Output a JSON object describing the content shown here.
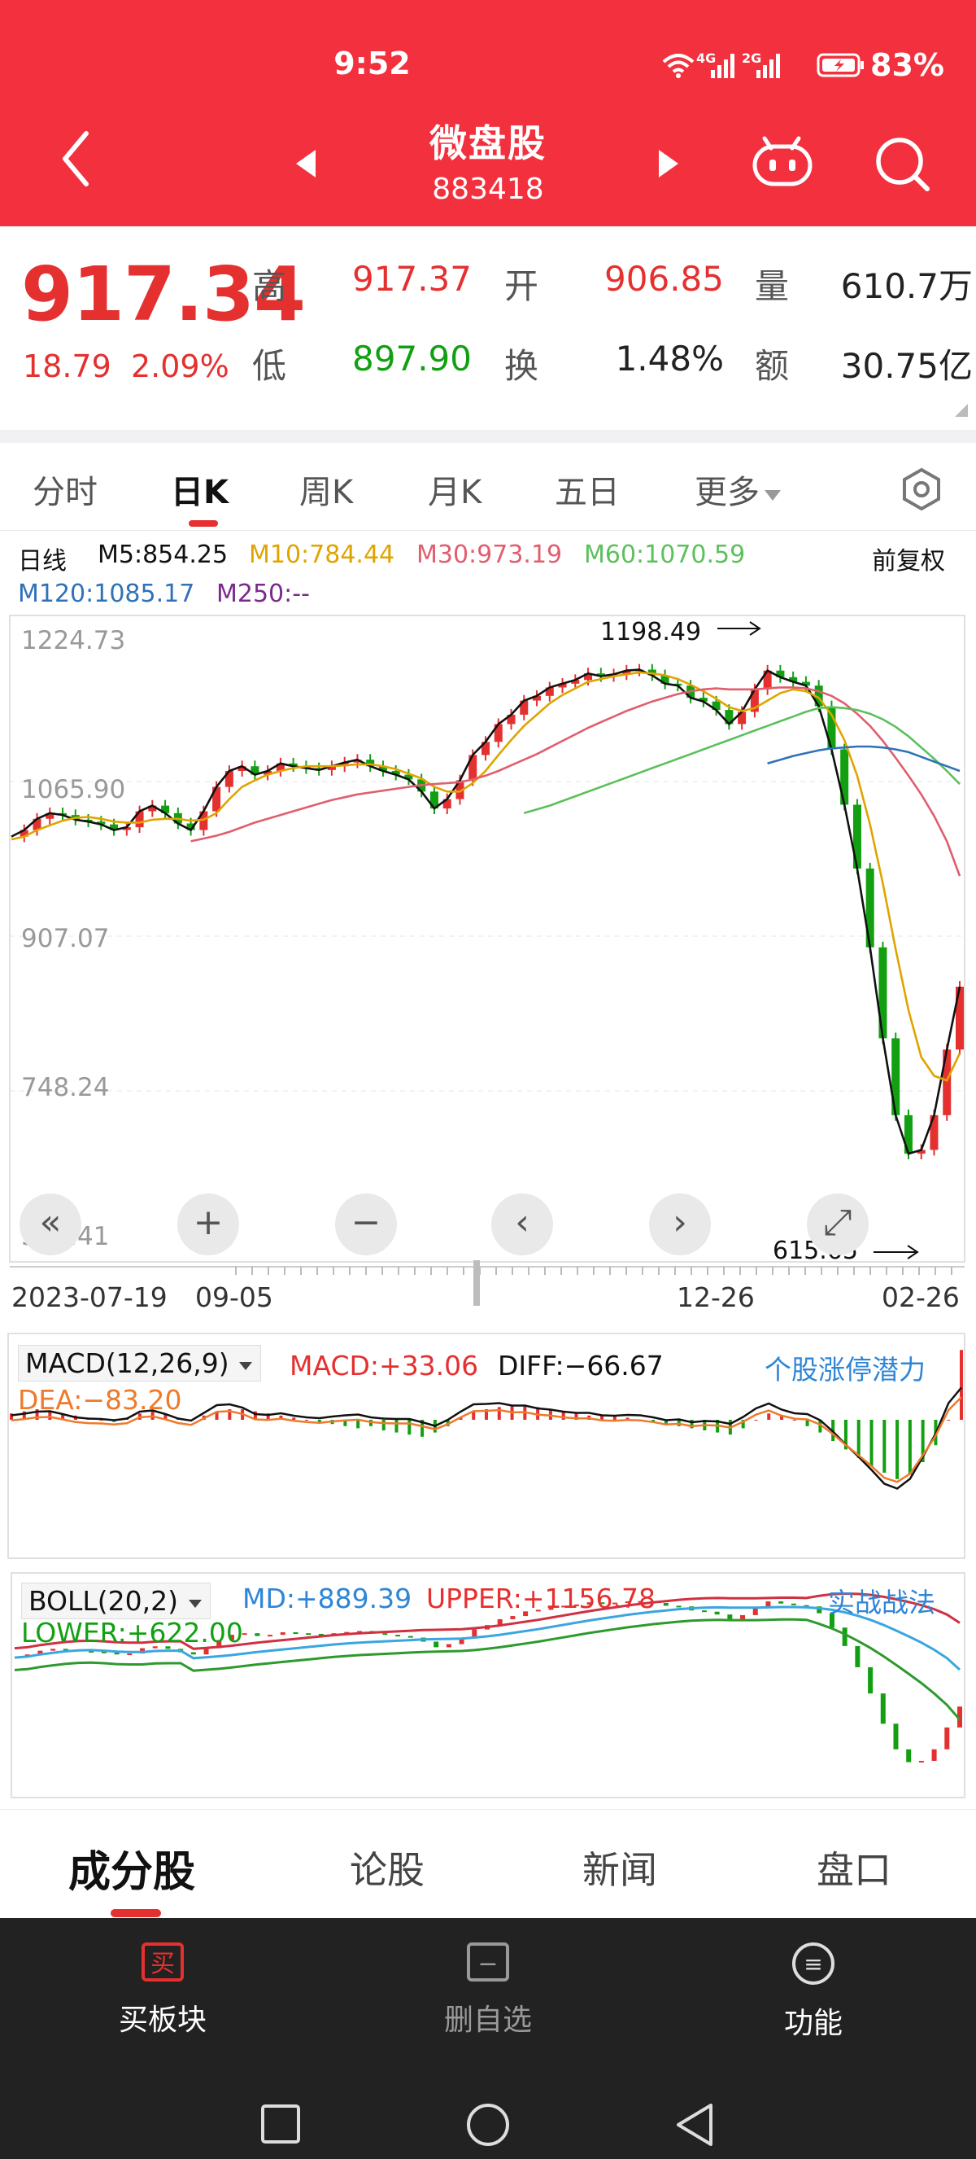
{
  "status_bar": {
    "time": "9:52",
    "net1": "4G",
    "net2": "2G",
    "battery": "83%"
  },
  "header": {
    "title": "微盘股",
    "code": "883418"
  },
  "quote": {
    "price": "917.34",
    "change": "18.79",
    "change_pct": "2.09%",
    "high_label": "高",
    "high": "917.37",
    "open_label": "开",
    "open": "906.85",
    "volume_label": "量",
    "volume": "610.7万",
    "low_label": "低",
    "low": "897.90",
    "turnover_label": "换",
    "turnover": "1.48%",
    "amount_label": "额",
    "amount": "30.75亿"
  },
  "tabs": [
    "分时",
    "日K",
    "周K",
    "月K",
    "五日",
    "更多"
  ],
  "ma_legend": {
    "period": "日线",
    "m5": "M5:854.25",
    "m10": "M10:784.44",
    "m30": "M30:973.19",
    "m60": "M60:1070.59",
    "m120": "M120:1085.17",
    "m250": "M250:--",
    "adjust": "前复权"
  },
  "controls": [
    "«",
    "+",
    "−",
    "‹",
    "›",
    "⤢"
  ],
  "chart_data": [
    {
      "type": "candlestick",
      "y_ticks": [
        "1224.73",
        "1065.90",
        "907.07",
        "748.24",
        "589.41"
      ],
      "ylim": [
        589.41,
        1224.73
      ],
      "x_labels": [
        "2023-07-19",
        "09-05",
        "12-26",
        "02-26"
      ],
      "annotations": {
        "high": "1198.49",
        "low": "615.65"
      },
      "series": [
        {
          "name": "M5",
          "color": "#111111",
          "values": [
            1015,
            1022,
            1034,
            1040,
            1038,
            1033,
            1031,
            1028,
            1022,
            1025,
            1042,
            1048,
            1040,
            1029,
            1022,
            1042,
            1068,
            1085,
            1090,
            1081,
            1085,
            1093,
            1090,
            1088,
            1086,
            1090,
            1094,
            1097,
            1090,
            1085,
            1081,
            1076,
            1063,
            1045,
            1055,
            1075,
            1102,
            1116,
            1135,
            1145,
            1160,
            1165,
            1174,
            1178,
            1182,
            1189,
            1186,
            1188,
            1192,
            1193,
            1187,
            1178,
            1176,
            1163,
            1159,
            1150,
            1135,
            1148,
            1172,
            1192,
            1185,
            1180,
            1176,
            1154,
            1108,
            1049,
            981,
            897,
            800,
            718,
            677,
            681,
            718,
            788,
            855
          ]
        },
        {
          "name": "M10",
          "color": "#e0a400",
          "values": [
            1012,
            1015,
            1022,
            1027,
            1032,
            1035,
            1036,
            1034,
            1031,
            1030,
            1030,
            1033,
            1034,
            1034,
            1032,
            1033,
            1040,
            1055,
            1068,
            1075,
            1081,
            1085,
            1088,
            1090,
            1090,
            1090,
            1091,
            1092,
            1092,
            1090,
            1087,
            1082,
            1077,
            1068,
            1063,
            1063,
            1072,
            1085,
            1102,
            1118,
            1133,
            1145,
            1157,
            1166,
            1173,
            1180,
            1183,
            1186,
            1188,
            1190,
            1189,
            1187,
            1183,
            1177,
            1170,
            1162,
            1153,
            1149,
            1152,
            1160,
            1168,
            1172,
            1170,
            1163,
            1145,
            1118,
            1080,
            1028,
            965,
            895,
            830,
            780,
            760,
            755,
            784
          ]
        },
        {
          "name": "M30",
          "color": "#e05e6e",
          "values": [
            null,
            null,
            null,
            null,
            null,
            null,
            null,
            null,
            null,
            null,
            null,
            null,
            null,
            null,
            1010,
            1013,
            1016,
            1020,
            1025,
            1030,
            1034,
            1038,
            1042,
            1046,
            1050,
            1054,
            1057,
            1060,
            1062,
            1064,
            1066,
            1068,
            1070,
            1071,
            1072,
            1073,
            1076,
            1080,
            1085,
            1091,
            1097,
            1103,
            1110,
            1117,
            1124,
            1131,
            1137,
            1143,
            1149,
            1154,
            1159,
            1163,
            1167,
            1170,
            1172,
            1173,
            1172,
            1172,
            1172,
            1173,
            1174,
            1174,
            1173,
            1170,
            1165,
            1157,
            1146,
            1133,
            1117,
            1099,
            1080,
            1060,
            1037,
            1010,
            973
          ]
        },
        {
          "name": "M60",
          "color": "#5cc05c",
          "values": [
            null,
            null,
            null,
            null,
            null,
            null,
            null,
            null,
            null,
            null,
            null,
            null,
            null,
            null,
            null,
            null,
            null,
            null,
            null,
            null,
            null,
            null,
            null,
            null,
            null,
            null,
            null,
            null,
            null,
            null,
            null,
            null,
            null,
            null,
            null,
            null,
            null,
            null,
            null,
            null,
            1040,
            1044,
            1048,
            1053,
            1058,
            1063,
            1068,
            1073,
            1078,
            1083,
            1088,
            1093,
            1098,
            1103,
            1108,
            1113,
            1118,
            1123,
            1128,
            1133,
            1138,
            1143,
            1148,
            1152,
            1153,
            1152,
            1150,
            1146,
            1140,
            1132,
            1122,
            1110,
            1098,
            1085,
            1071
          ]
        },
        {
          "name": "M120",
          "color": "#2f72b8",
          "values": [
            null,
            null,
            null,
            null,
            null,
            null,
            null,
            null,
            null,
            null,
            null,
            null,
            null,
            null,
            null,
            null,
            null,
            null,
            null,
            null,
            null,
            null,
            null,
            null,
            null,
            null,
            null,
            null,
            null,
            null,
            null,
            null,
            null,
            null,
            null,
            null,
            null,
            null,
            null,
            null,
            null,
            null,
            null,
            null,
            null,
            null,
            null,
            null,
            null,
            null,
            null,
            null,
            null,
            null,
            null,
            null,
            null,
            null,
            null,
            1093,
            1097,
            1101,
            1104,
            1107,
            1109,
            1110,
            1111,
            1111,
            1110,
            1108,
            1105,
            1100,
            1095,
            1090,
            1085
          ]
        }
      ]
    },
    {
      "type": "macd",
      "params": "MACD(12,26,9)",
      "macd": "MACD:+33.06",
      "diff": "DIFF:−66.67",
      "dea": "DEA:−83.20",
      "values": [
        3,
        4,
        5,
        4,
        3,
        2,
        1,
        0,
        -1,
        1,
        3,
        4,
        3,
        1,
        0,
        2,
        4,
        5,
        5,
        4,
        3,
        2,
        1,
        0,
        -1,
        -2,
        -3,
        -4,
        -3,
        -5,
        -6,
        -7,
        -8,
        -6,
        -3,
        1,
        4,
        5,
        6,
        7,
        7,
        6,
        5,
        4,
        3,
        2,
        2,
        2,
        1,
        0,
        -1,
        -2,
        -3,
        -4,
        -5,
        -6,
        -7,
        -4,
        0,
        3,
        2,
        0,
        -3,
        -6,
        -10,
        -14,
        -18,
        -22,
        -25,
        -28,
        -26,
        -20,
        -12,
        0,
        33
      ]
    },
    {
      "type": "boll",
      "params": "BOLL(20,2)",
      "md": "MD:+889.39",
      "upper": "UPPER:+1156.78",
      "lower": "LOWER:+622.00"
    }
  ],
  "links": {
    "limit_up": "个股涨停潜力",
    "tactics": "实战战法"
  },
  "bottom_tabs": [
    "成分股",
    "论股",
    "新闻",
    "盘口"
  ],
  "dock": [
    {
      "label": "买板块",
      "icon_char": "买"
    },
    {
      "label": "删自选",
      "icon_char": "−"
    },
    {
      "label": "功能",
      "icon_char": "≡"
    }
  ],
  "colors": {
    "brand_red": "#f2303e",
    "up_red": "#e53030",
    "down_green": "#12a012"
  }
}
